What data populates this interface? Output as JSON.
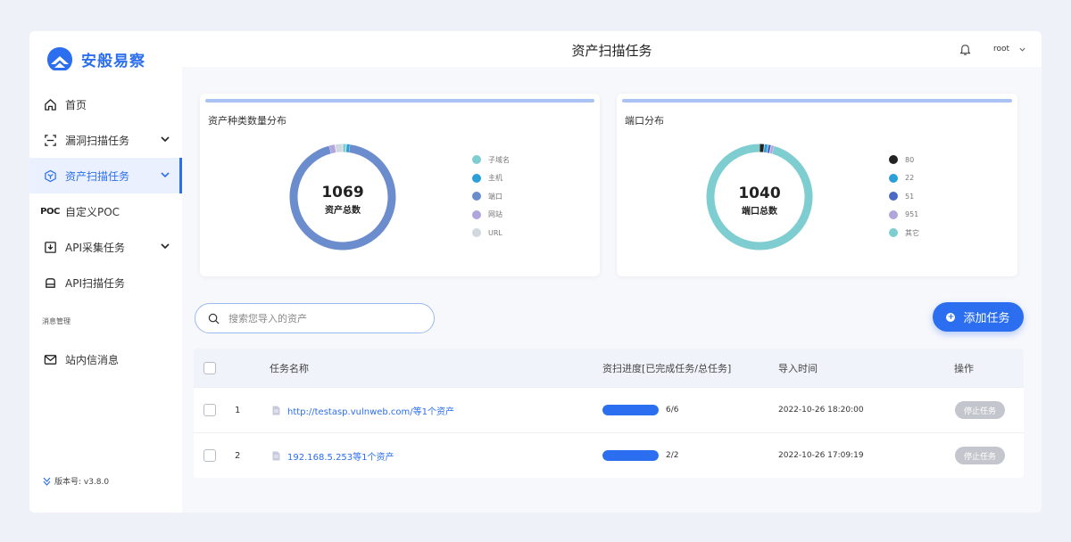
{
  "app": {
    "logo_text": "安般易察",
    "version": "版本号: v3.8.0"
  },
  "header": {
    "title": "资产扫描任务",
    "user": "root"
  },
  "sidebar": {
    "items": [
      {
        "label": "首页",
        "icon": "home-icon"
      },
      {
        "label": "漏洞扫描任务",
        "icon": "scan-icon"
      },
      {
        "label": "资产扫描任务",
        "icon": "hexagon-icon"
      },
      {
        "label": "自定义POC",
        "icon": "poc-icon"
      },
      {
        "label": "API采集任务",
        "icon": "download-icon"
      },
      {
        "label": "API扫描任务",
        "icon": "api-scan-icon"
      }
    ],
    "section_label": "消息管理",
    "message_item": "站内信消息",
    "poc_icon_text": "POC"
  },
  "asset_chart": {
    "title": "资产种类数量分布",
    "total": "1069",
    "total_label": "资产总数"
  },
  "port_chart": {
    "title": "端口分布",
    "total": "1040",
    "total_label": "端口总数"
  },
  "chart_data": [
    {
      "type": "pie",
      "title": "资产种类数量分布",
      "categories": [
        "子域名",
        "主机",
        "端口",
        "网站",
        "URL"
      ],
      "values": [
        12,
        12,
        1000,
        20,
        25
      ],
      "colors": [
        "#7ecdd0",
        "#2d9fd8",
        "#6b8ccd",
        "#b1a6dc",
        "#d2d8e0"
      ]
    },
    {
      "type": "pie",
      "title": "端口分布",
      "categories": [
        "80",
        "22",
        "51",
        "951",
        "其它"
      ],
      "values": [
        15,
        12,
        10,
        10,
        993
      ],
      "colors": [
        "#222222",
        "#2d9fd8",
        "#4a6ac4",
        "#b1a6dc",
        "#7ecdd0"
      ]
    }
  ],
  "search": {
    "placeholder": "搜索您导入的资产"
  },
  "add_button": "添加任务",
  "table": {
    "headers": [
      "任务名称",
      "资扫进度[已完成任务/总任务]",
      "导入时间",
      "操作"
    ],
    "rows": [
      {
        "index": "1",
        "name": "http://testasp.vulnweb.com/等1个资产",
        "progress": 1.0,
        "progress_text": "6/6",
        "time": "2022-10-26 18:20:00",
        "action": "停止任务"
      },
      {
        "index": "2",
        "name": "192.168.5.253等1个资产",
        "progress": 1.0,
        "progress_text": "2/2",
        "time": "2022-10-26 17:09:19",
        "action": "停止任务"
      }
    ]
  }
}
